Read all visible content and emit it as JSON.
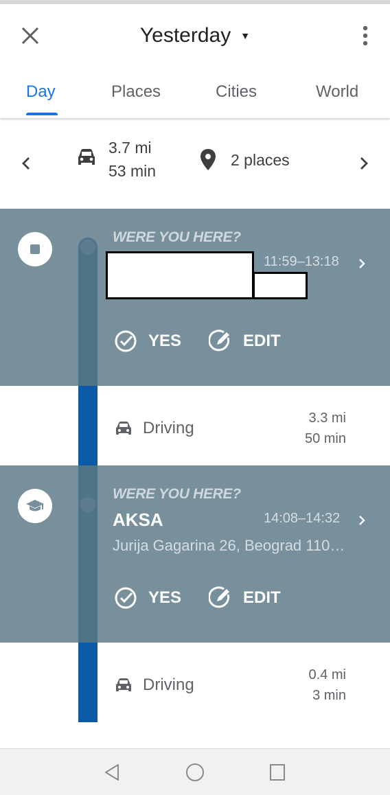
{
  "header": {
    "title": "Yesterday",
    "tabs": [
      {
        "label": "Day",
        "active": true
      },
      {
        "label": "Places",
        "active": false
      },
      {
        "label": "Cities",
        "active": false
      },
      {
        "label": "World",
        "active": false
      }
    ]
  },
  "summary": {
    "distance": "3.7 mi",
    "duration": "53 min",
    "places": "2 places"
  },
  "cards": [
    {
      "prompt": "WERE YOU HERE?",
      "time": "11:59–13:18",
      "name": "",
      "address": "",
      "yes_label": "YES",
      "edit_label": "EDIT",
      "icon": "stop-icon"
    },
    {
      "prompt": "WERE YOU HERE?",
      "time": "14:08–14:32",
      "name": "AKSA",
      "address": "Jurija Gagarina 26, Beograd 110…",
      "yes_label": "YES",
      "edit_label": "EDIT",
      "icon": "school-icon"
    }
  ],
  "drives": [
    {
      "label": "Driving",
      "distance": "3.3 mi",
      "duration": "50 min"
    },
    {
      "label": "Driving",
      "distance": "0.4 mi",
      "duration": "3 min"
    }
  ],
  "colors": {
    "accent": "#1a73e8",
    "card_background": "#78909c",
    "timeline_blue": "#0b5aa8"
  }
}
